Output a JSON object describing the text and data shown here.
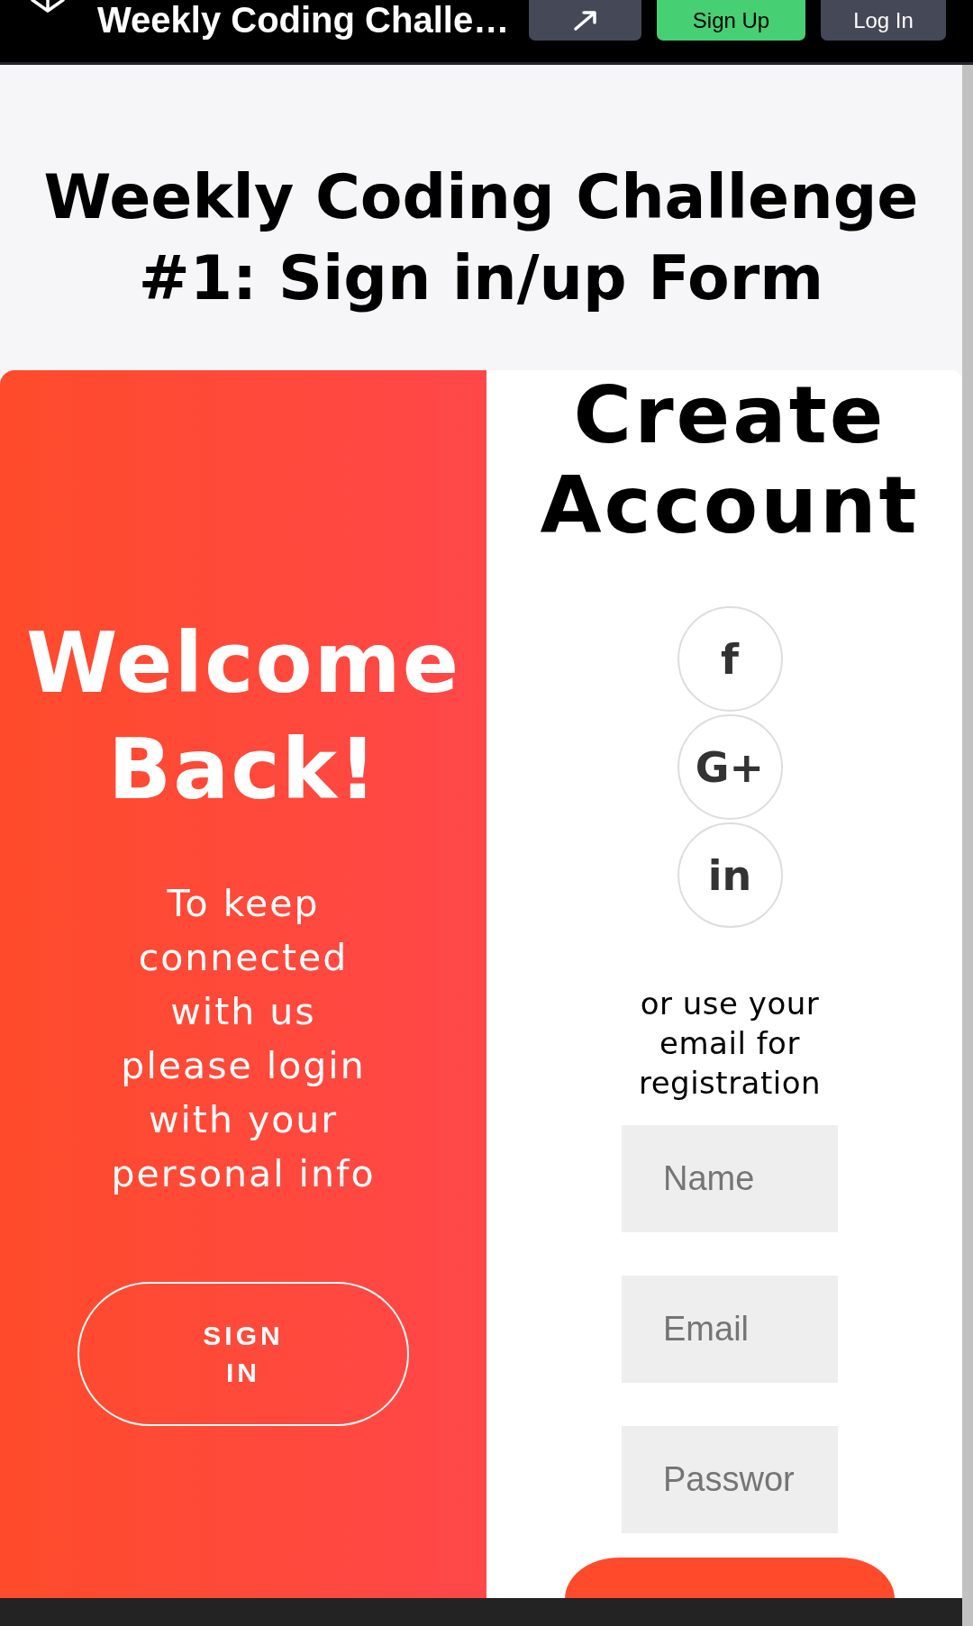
{
  "header": {
    "title": "Weekly Coding Challe…",
    "buttons": [
      {
        "kind": "icon"
      },
      {
        "kind": "primary",
        "label": "Sign Up"
      },
      {
        "kind": "secondary",
        "label": "Log In"
      }
    ]
  },
  "page_title": "Weekly Coding Challenge #1: Sign in/up Form",
  "overlay": {
    "heading": "Welcome Back!",
    "text": "To keep connected with us please login with your personal info",
    "button": "SIGN IN"
  },
  "signup": {
    "heading": "Create Account",
    "social_buttons": [
      {
        "label": "f"
      },
      {
        "label": "G+"
      },
      {
        "label": "in"
      }
    ],
    "note": "or use your email for registration",
    "fields": [
      {
        "placeholder": "Name"
      },
      {
        "placeholder": "Email"
      },
      {
        "placeholder": "Passwor"
      }
    ]
  }
}
